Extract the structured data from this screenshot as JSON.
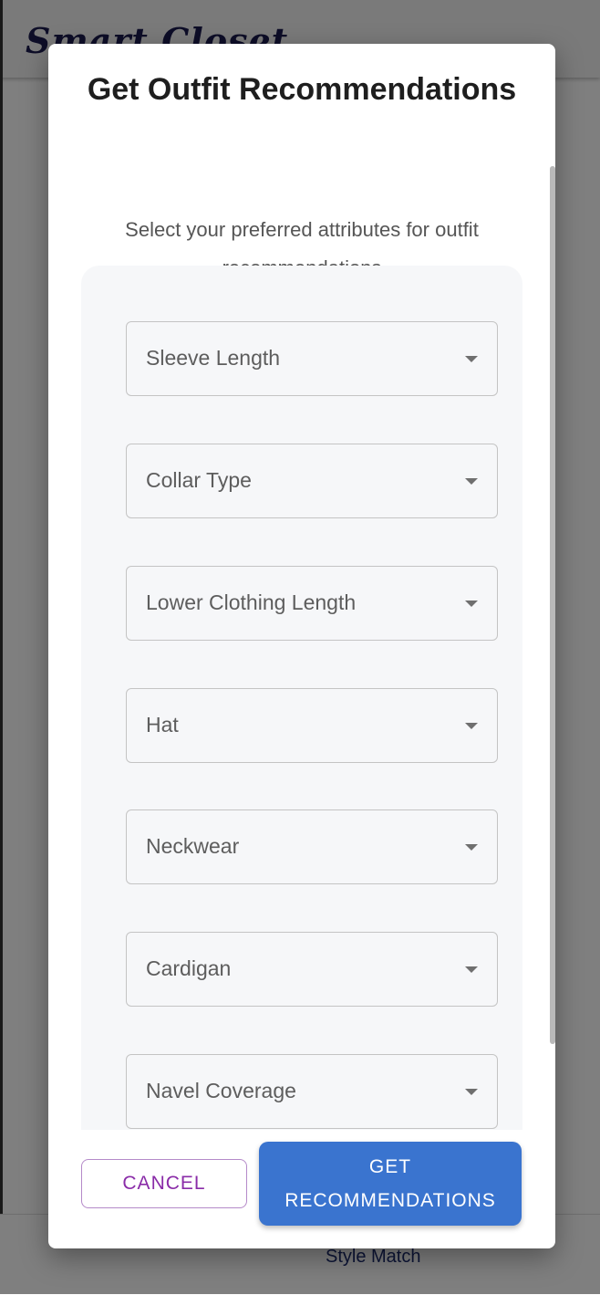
{
  "app": {
    "title": "Smart Closet",
    "bottom_nav": [
      {
        "label": "",
        "icon": "home-icon"
      },
      {
        "label": "",
        "icon": "hanger-icon"
      },
      {
        "label": "Style Match",
        "icon": "style-match-icon"
      },
      {
        "label": "",
        "icon": "plus-icon"
      }
    ]
  },
  "dialog": {
    "title": "Get Outfit Recommendations",
    "subtitle": "Select your preferred attributes for outfit recommendations",
    "selects": [
      {
        "label": "Sleeve Length",
        "value": ""
      },
      {
        "label": "Collar Type",
        "value": ""
      },
      {
        "label": "Lower Clothing Length",
        "value": ""
      },
      {
        "label": "Hat",
        "value": ""
      },
      {
        "label": "Neckwear",
        "value": ""
      },
      {
        "label": "Cardigan",
        "value": ""
      },
      {
        "label": "Navel Coverage",
        "value": ""
      }
    ],
    "cancel_label": "CANCEL",
    "submit_label_line1": "GET",
    "submit_label_line2": "RECOMMENDATIONS"
  },
  "colors": {
    "primary": "#3a74cf",
    "cancel": "#8a2ca8",
    "title_dark": "#1a1a4e"
  }
}
